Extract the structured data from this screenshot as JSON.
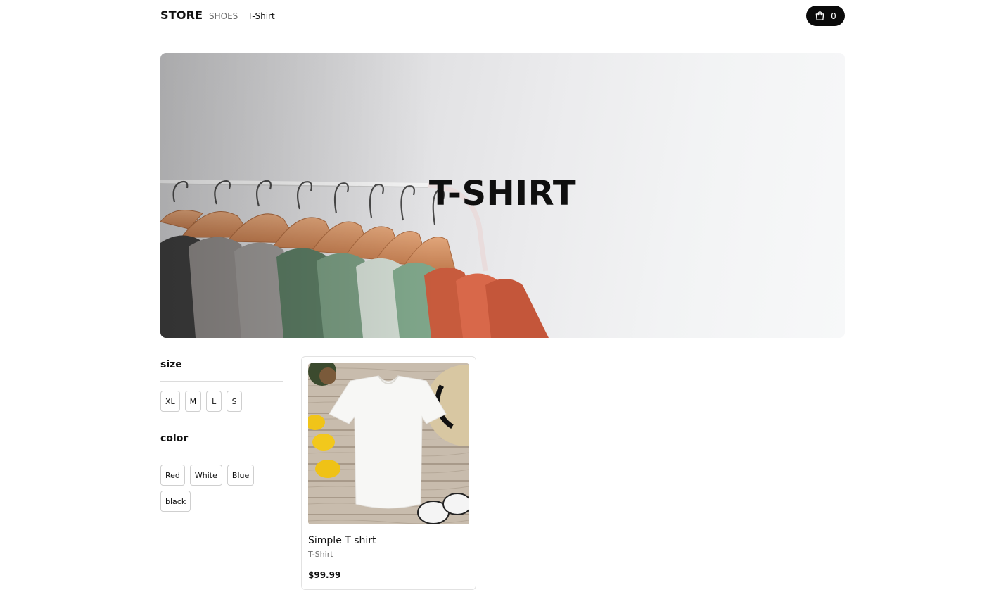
{
  "header": {
    "logo": "STORE",
    "nav": [
      {
        "label": "SHOES"
      },
      {
        "label": "T-Shirt"
      }
    ],
    "cart": {
      "icon": "shopping-bag-icon",
      "count": "0"
    }
  },
  "hero": {
    "title": "T-SHIRT"
  },
  "filters": {
    "size": {
      "heading": "size",
      "options": [
        "XL",
        "M",
        "L",
        "S"
      ]
    },
    "color": {
      "heading": "color",
      "options": [
        "Red",
        "White",
        "Blue",
        "black"
      ]
    }
  },
  "products": [
    {
      "name": "Simple T shirt",
      "category": "T-Shirt",
      "price": "$99.99"
    }
  ],
  "colors": {
    "accent": "#0a0a0a",
    "border": "#e2e2e2",
    "muted_text": "#707070"
  }
}
